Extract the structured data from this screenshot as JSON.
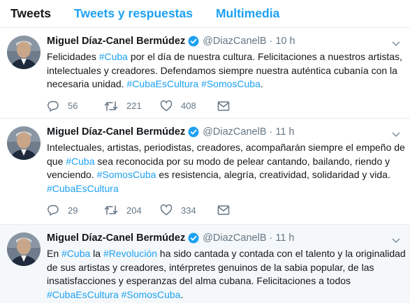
{
  "tabs": [
    "Tweets",
    "Tweets y respuestas",
    "Multimedia"
  ],
  "accent_color": "#1da1f2",
  "tweets": [
    {
      "name": "Miguel Díaz-Canel Bermúdez",
      "handle": "@DiazCanelB",
      "dot": "·",
      "time": "10 h",
      "text_lines": [
        [
          {
            "t": "Felicidades "
          },
          {
            "t": "#Cuba",
            "tag": true
          },
          {
            "t": " por el día de nuestra cultura. Felicitaciones a nuestros artistas,"
          }
        ],
        [
          {
            "t": "intelectuales y creadores. Defendamos siempre nuestra auténtica  cubanía con la"
          }
        ],
        [
          {
            "t": "necesaria unidad. "
          },
          {
            "t": "#CubaEsCultura",
            "tag": true
          },
          {
            "t": " "
          },
          {
            "t": "#SomosCuba",
            "tag": true
          },
          {
            "t": "."
          }
        ]
      ],
      "replies": "56",
      "retweets": "221",
      "likes": "408",
      "icons": [
        "reply-icon",
        "retweet-icon",
        "like-icon",
        "message-icon"
      ]
    },
    {
      "name": "Miguel Díaz-Canel Bermúdez",
      "handle": "@DiazCanelB",
      "dot": "·",
      "time": "11 h",
      "text_lines": [
        [
          {
            "t": "Intelectuales, artistas, periodistas, creadores, acompañarán siempre el empeño de"
          }
        ],
        [
          {
            "t": "que "
          },
          {
            "t": "#Cuba",
            "tag": true
          },
          {
            "t": " sea reconocida por su modo de pelear cantando, bailando, riendo y"
          }
        ],
        [
          {
            "t": "venciendo. "
          },
          {
            "t": "#SomosCuba",
            "tag": true
          },
          {
            "t": " es resistencia, alegría, creatividad, solidaridad y vida."
          }
        ],
        [
          {
            "t": "#CubaEsCultura",
            "tag": true
          }
        ]
      ],
      "replies": "29",
      "retweets": "204",
      "likes": "334",
      "icons": [
        "reply-icon",
        "retweet-icon",
        "like-icon",
        "message-icon"
      ]
    },
    {
      "name": "Miguel Díaz-Canel Bermúdez",
      "handle": "@DiazCanelB",
      "dot": "·",
      "time": "11 h",
      "text_lines": [
        [
          {
            "t": "En "
          },
          {
            "t": "#Cuba",
            "tag": true
          },
          {
            "t": " la "
          },
          {
            "t": "#Revolución",
            "tag": true
          },
          {
            "t": " ha sido cantada y contada con el talento y la originalidad"
          }
        ],
        [
          {
            "t": "de sus artistas y creadores, intérpretes genuinos de la sabia popular, de las"
          }
        ],
        [
          {
            "t": "insatisfacciones y esperanzas del alma cubana. Felicitaciones a todos"
          }
        ],
        [
          {
            "t": "#CubaEsCultura",
            "tag": true
          },
          {
            "t": " "
          },
          {
            "t": "#SomosCuba",
            "tag": true
          },
          {
            "t": "."
          }
        ]
      ]
    }
  ]
}
